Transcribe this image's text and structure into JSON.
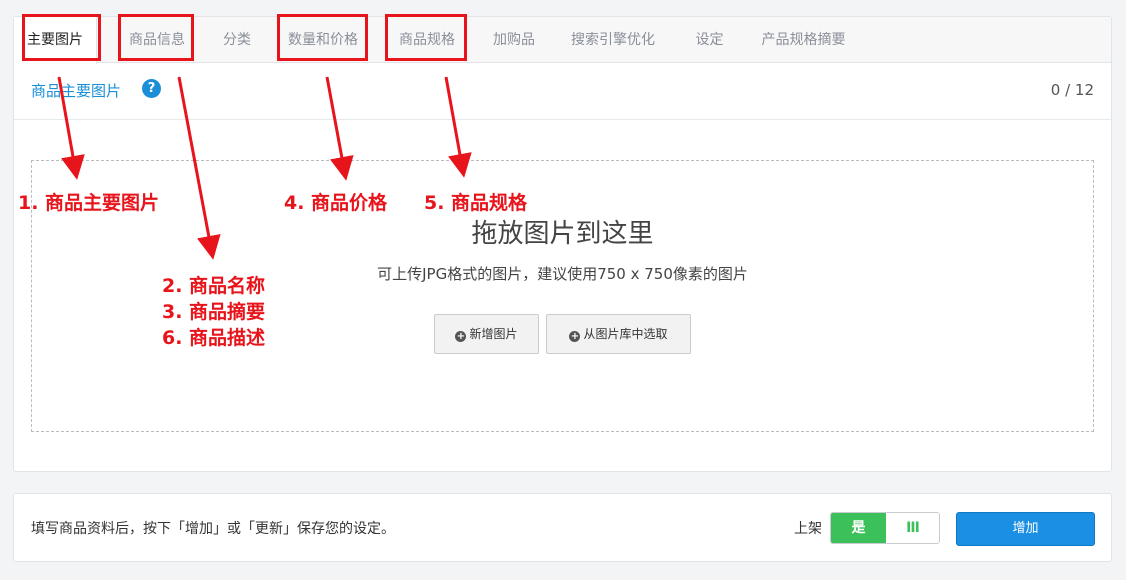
{
  "tabs": [
    {
      "label": "主要图片",
      "active": true
    },
    {
      "label": "商品信息"
    },
    {
      "label": "分类"
    },
    {
      "label": "数量和价格"
    },
    {
      "label": "商品规格"
    },
    {
      "label": "加购品"
    },
    {
      "label": "搜索引擎优化"
    },
    {
      "label": "设定"
    },
    {
      "label": "产品规格摘要"
    }
  ],
  "section": {
    "title": "商品主要图片",
    "help_icon": "question-circle-icon",
    "counter": "0 / 12"
  },
  "dropzone": {
    "title": "拖放图片到这里",
    "hint": "可上传JPG格式的图片，建议使用750 x 750像素的图片",
    "add_image_label": "新增图片",
    "library_label": "从图片库中选取",
    "button_icon": "plus-circle-icon"
  },
  "footer": {
    "hint": "填写商品资料后，按下「增加」或「更新」保存您的设定。",
    "shelf_label": "上架",
    "toggle_on_label": "是",
    "toggle_grip": "III",
    "add_label": "增加"
  },
  "annotations": {
    "color": "#e8141b",
    "main_image": "1. 商品主要图片",
    "name": "2. 商品名称",
    "summary": "3. 商品摘要",
    "description": "6. 商品描述",
    "price": "4. 商品价格",
    "spec": "5. 商品规格"
  },
  "colors": {
    "accent": "#1a8fd8",
    "primary_button": "#1a8fe3",
    "toggle_on": "#3cc05a",
    "annotation": "#e8141b"
  }
}
